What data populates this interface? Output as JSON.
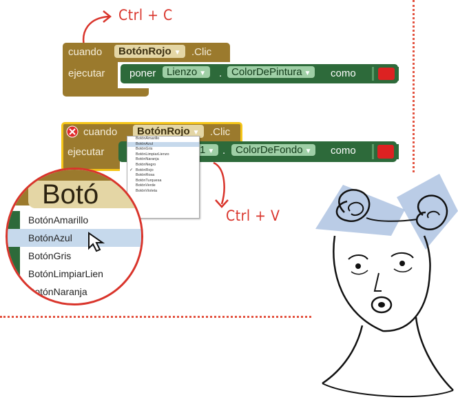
{
  "annotations": {
    "copy_label": "Ctrl + C",
    "paste_label": "Ctrl + V"
  },
  "block1": {
    "event_keyword": "cuando",
    "component": "BotónRojo",
    "event": ".Clic",
    "do_keyword": "ejecutar",
    "set_keyword": "poner",
    "target": "Lienzo",
    "dot": ".",
    "property": "ColorDePintura",
    "to_keyword": "como"
  },
  "block2": {
    "event_keyword": "cuando",
    "component": "BotónRojo",
    "event": ".Clic",
    "do_keyword": "ejecutar",
    "target_partial": "1",
    "dot": ".",
    "property": "ColorDeFondo",
    "to_keyword": "como"
  },
  "dropdown": {
    "items": [
      "BotónAmarillo",
      "BotónAzul",
      "BotónGris",
      "BotónLimpiarLienzo",
      "BotónNaranja",
      "BotónNegro",
      "BotónRojo",
      "BotónRosa",
      "BotónTurquesa",
      "BotónVerde",
      "BotónVioleta"
    ],
    "highlighted": "BotónAzul",
    "checked": "BotónRojo"
  },
  "magnifier": {
    "header_text": "Botó",
    "items": [
      "BotónAmarillo",
      "BotónAzul",
      "BotónGris",
      "BotónLimpiarLien",
      "BotónNaranja"
    ]
  },
  "colors": {
    "accent": "#d9342b",
    "event_block": "#9b7a2d",
    "set_block": "#2d6a3a",
    "selection": "#c6d9ec",
    "highlight_outline": "#f5c518"
  }
}
